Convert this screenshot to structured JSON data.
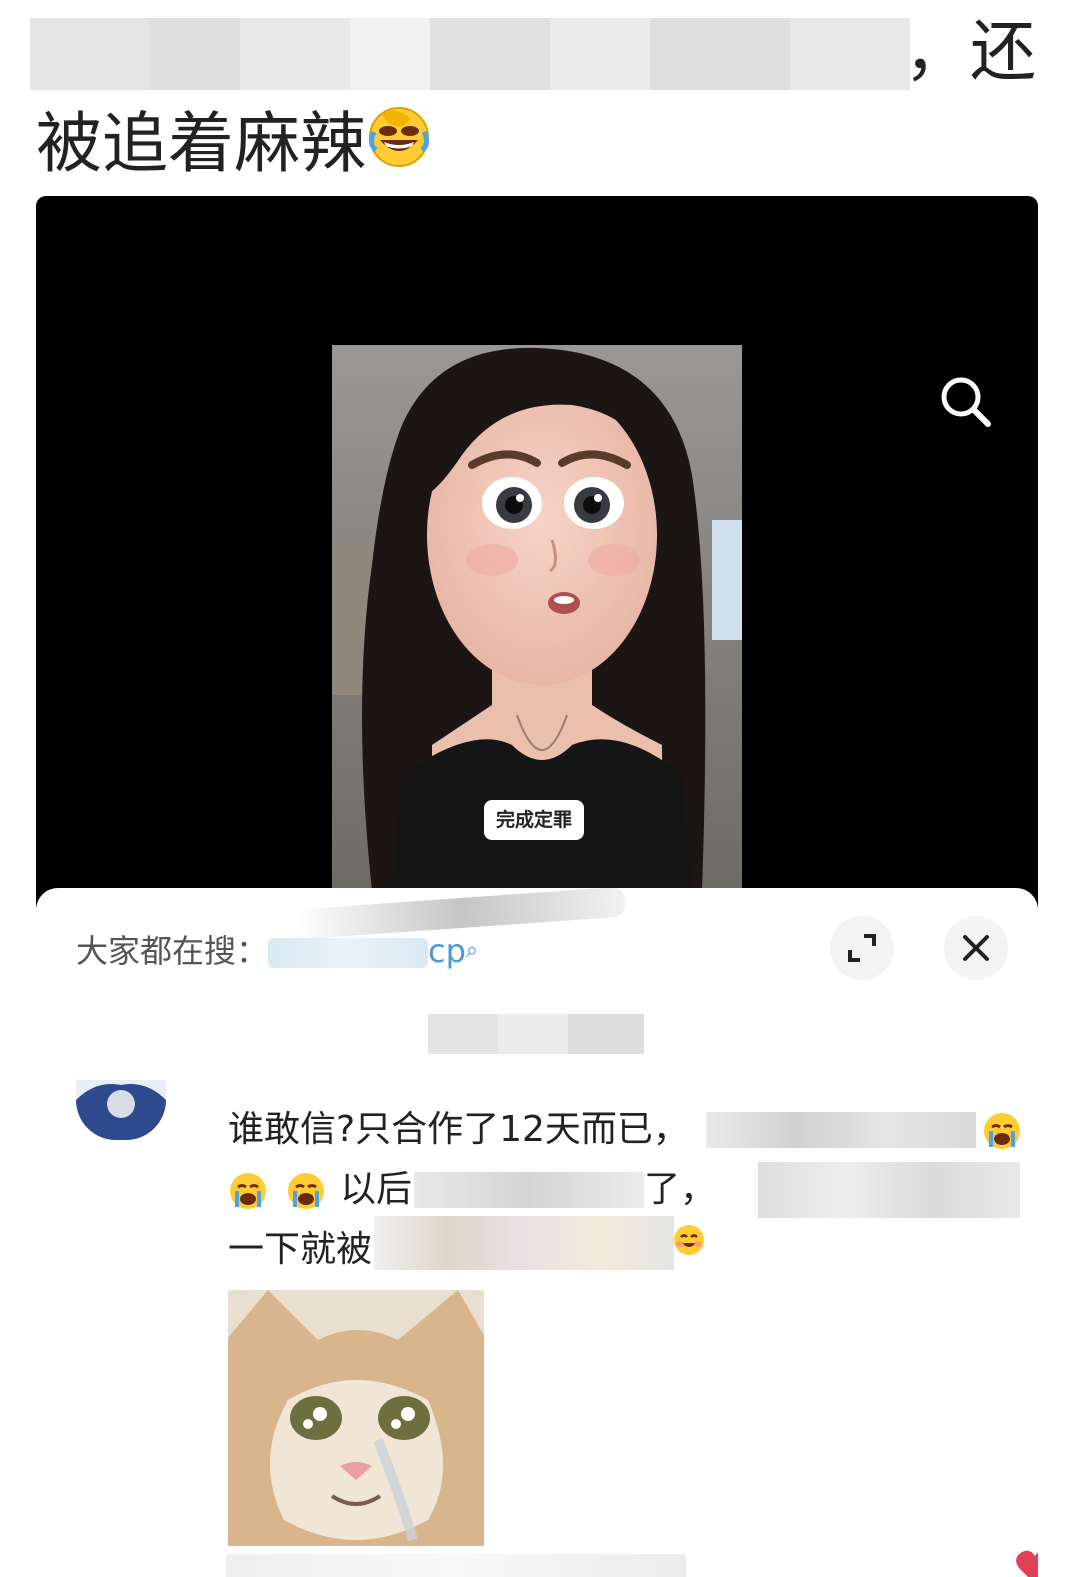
{
  "caption": {
    "line1_tail": "，还",
    "line2": "被追着麻辣",
    "emoji": "rolling-laughing-emoji"
  },
  "video": {
    "overlay_label": "完成定罪",
    "search_icon": "search-icon"
  },
  "sheet": {
    "search_prefix": "大家都在搜：",
    "search_term_visible": "cp",
    "expand_icon": "expand-icon",
    "close_icon": "close-icon"
  },
  "comment": {
    "avatar": "avatar",
    "line1": "谁敢信?只合作了12天而已，",
    "line2_prefix": "以后",
    "line2_mid": "了，",
    "line3_prefix": "一下就被",
    "emojis": [
      "crying-emoji",
      "crying-emoji",
      "crying-emoji",
      "smiling-emoji"
    ],
    "sticker": "crying-cat-sticker",
    "like_icon": "heart-icon"
  },
  "colors": {
    "page_bg": "#ffffff",
    "video_bg": "#000000",
    "text_primary": "#222222",
    "search_term": "#4a9ad8",
    "like": "#e0405a"
  }
}
